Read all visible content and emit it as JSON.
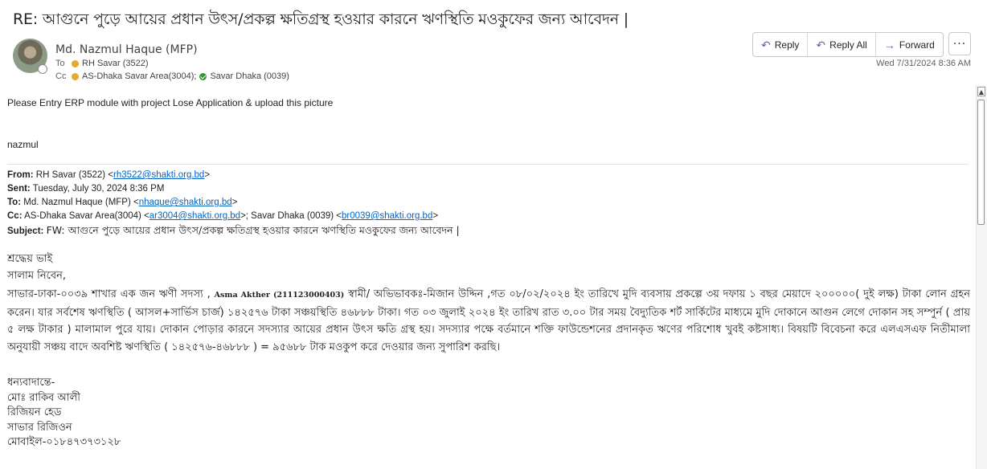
{
  "subject": "RE:  আগুনে পুড়ে আয়ের প্রধান উৎস/প্রকল্প ক্ষতিগ্রস্থ হওয়ার কারনে ঋণস্থিতি মওকুফের জন্য আবেদন |",
  "sender": {
    "name": "Md. Nazmul Haque (MFP)",
    "to_label": "To",
    "to": "RH Savar (3522)",
    "cc_label": "Cc",
    "cc": [
      "AS-Dhaka Savar Area(3004);",
      "Savar Dhaka (0039)"
    ]
  },
  "date": "Wed 7/31/2024 8:36 AM",
  "actions": {
    "reply": "Reply",
    "reply_all": "Reply All",
    "forward": "Forward",
    "more": "···"
  },
  "body": {
    "intro": "Please Entry ERP module with project Lose Application & upload this picture",
    "signoff": "nazmul"
  },
  "forwarded": {
    "from_label": "From:",
    "from_name": "RH Savar (3522) <",
    "from_email": "rh3522@shakti.org.bd",
    "sent_label": "Sent:",
    "sent": "Tuesday, July 30, 2024 8:36 PM",
    "to_label": "To:",
    "to_name": "Md. Nazmul Haque (MFP) <",
    "to_email": "nhaque@shakti.org.bd",
    "cc_label": "Cc:",
    "cc_name1": "AS-Dhaka Savar Area(3004) <",
    "cc_email1": "ar3004@shakti.org.bd",
    "cc_name2": ">; Savar Dhaka (0039) <",
    "cc_email2": "br0039@shakti.org.bd",
    "subject_label": "Subject:",
    "subject": "FW: আগুনে পুড়ে আয়ের প্রধান উৎস/প্রকল্প ক্ষতিগ্রস্থ হওয়ার কারনে ঋণস্থিতি মওকুফের জন্য আবেদন |",
    "greeting": "শ্রদ্ধেয় ভাই",
    "salam": "সালাম নিবেন,",
    "para_a": "সাভার-ঢাকা-০০৩৯ শাখার এক জন ঋণী  সদস্য , ",
    "para_name": "Asma Akther (211123000403)",
    "para_b": " স্বামী/ অভিভাবকঃ-মিজান উদ্দিন ,গত ০৮/০২/২০২৪ ইং তারিখে  মুদি ব্যবসায় প্রকল্পে ৩য় দফায়  ১ বছর মেয়াদে ২০০০০০( দুই লক্ষ) টাকা লোন গ্রহন করেন।  যার সর্বশেষ ঋণস্থিতি ( আসল+সার্ভিস চার্জ) ১৪২৫৭৬ টাকা  সঞ্চয়স্থিতি ৪৬৮৮৮ টাকা।   গত ০৩ জুলাই ২০২৪ ইং তারিখ রাত ৩.০০ টার সময় বৈদ্যুতিক শর্ট সার্কিটের মাধ্যমে  মুদি দোকানে  আগুন লেগে  দোকান সহ সম্পুর্ন ( প্রায় ৫ লক্ষ টাকার ) মালামাল পুরে যায়।  দোকান পোড়ার কারনে সদস্যার আয়ের প্রধান উৎস ক্ষতি গ্রস্থ হয়।   সদস্যার পক্ষে বর্তমানে শক্তি ফাউন্ডেশনের প্রদানকৃত ঋণের  পরিশোধ খুবই কষ্টসাধ্য।  বিষয়টি বিবেচনা করে  এলএসএফ নিতীমালা অনুযায়ী  সঞ্চয় বাদে অবশিষ্ট ঋণস্থিতি ( ১৪২৫৭৬-৪৬৮৮৮ ) = ৯৫৬৮৮ টাক মওকুপ করে দেওয়ার জন্য সুপারিশ করছি।",
    "closing": [
      "ধন্যবাদান্তে-",
      "মোঃ রাকিব  আলী",
      "রিজিয়ন হেড",
      "সাভার রিজিওন",
      "মোবাইল-০১৮৪৭৩৭৩১২৮"
    ]
  }
}
